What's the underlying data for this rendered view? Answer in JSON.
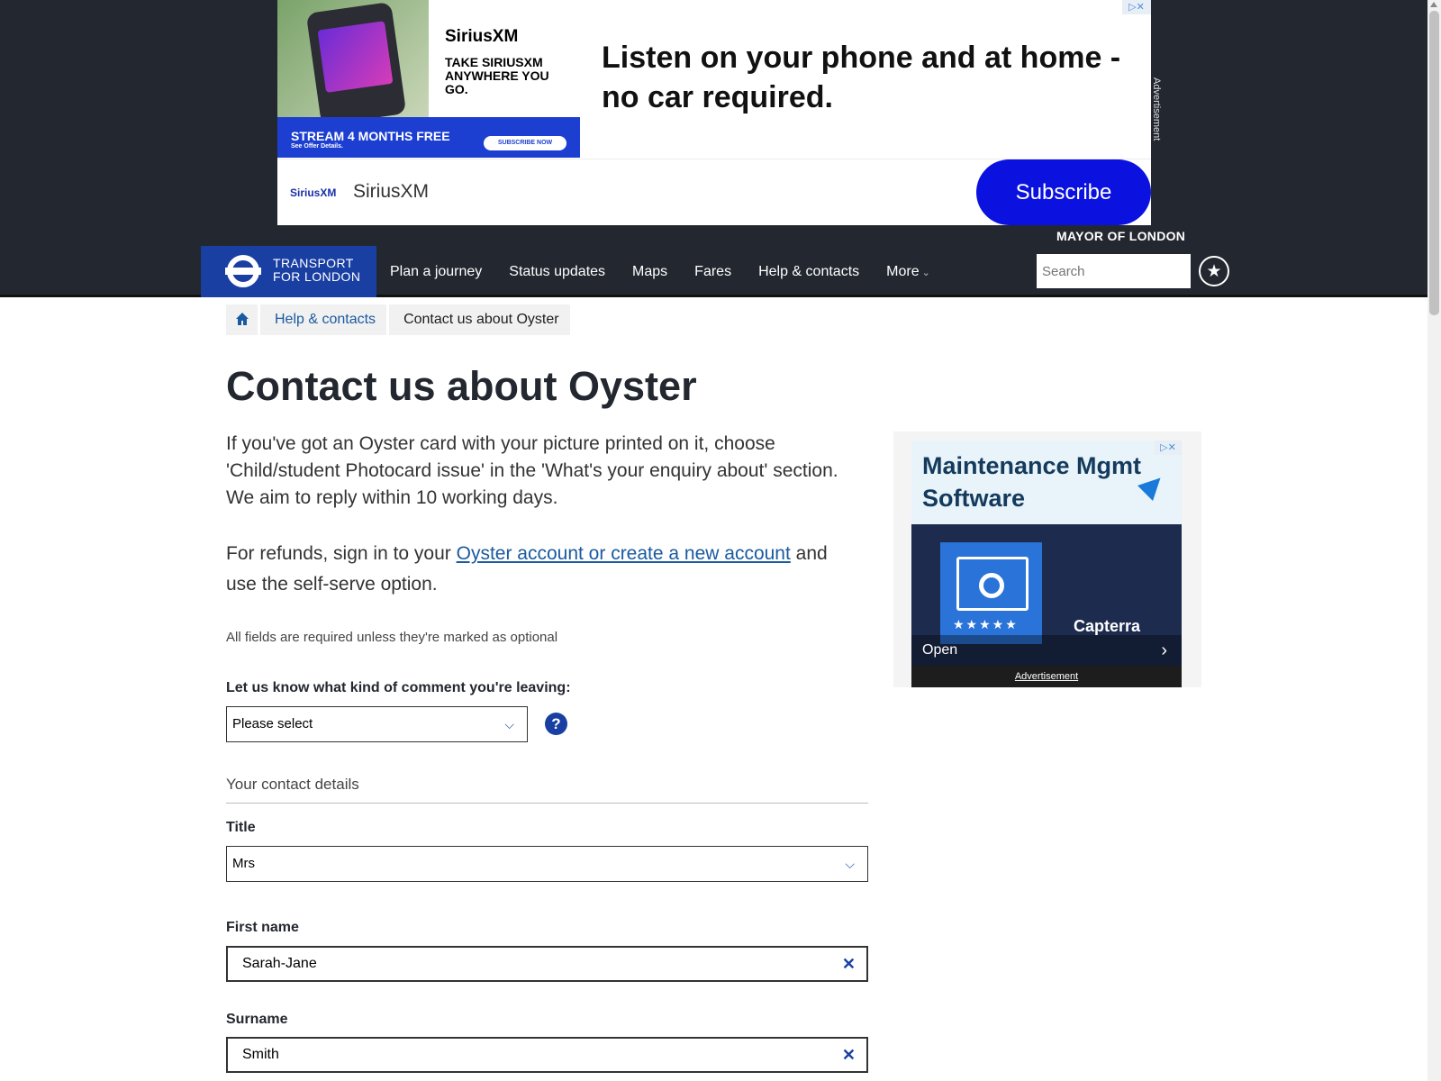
{
  "top_ad": {
    "brand": "SiriusXM",
    "tagline": "TAKE SIRIUSXM ANYWHERE YOU GO.",
    "offer": "STREAM 4 MONTHS FREE",
    "offer_sub": "See Offer Details.",
    "offer_button": "SUBSCRIBE NOW",
    "headline": "Listen on your phone and at home - no car required.",
    "small_logo": "SiriusXM",
    "sponsor": "SiriusXM",
    "cta": "Subscribe",
    "side_label": "Advertisement"
  },
  "header": {
    "mayor": "MAYOR OF LONDON",
    "brand_line1": "TRANSPORT",
    "brand_line2": "FOR LONDON",
    "nav": [
      "Plan a journey",
      "Status updates",
      "Maps",
      "Fares",
      "Help & contacts",
      "More"
    ],
    "search_placeholder": "Search"
  },
  "breadcrumb": {
    "items": [
      "Help & contacts",
      "Contact us about Oyster"
    ]
  },
  "main": {
    "title": "Contact us about Oyster",
    "intro": "If you've got an Oyster card with your picture printed on it, choose 'Child/student Photocard issue' in the 'What's your enquiry about' section. We aim to reply within 10 working days.",
    "refund_prefix": "For refunds, sign in to your ",
    "refund_link": "Oyster account or create a new account",
    "refund_suffix": " and use the self-serve option.",
    "required_note": "All fields are required unless they're marked as optional",
    "comment_label": "Let us know what kind of comment you're leaving:",
    "comment_value": "Please select",
    "contact_section": "Your contact details",
    "title_label": "Title",
    "title_value": "Mrs",
    "first_name_label": "First name",
    "first_name_value": "Sarah-Jane",
    "surname_label": "Surname",
    "surname_value": "Smith"
  },
  "side_ad": {
    "headline": "Maintenance Mgmt Software",
    "brand": "Capterra",
    "cta": "Open",
    "label": "Advertisement"
  },
  "icons": {
    "home": "home-icon",
    "star": "star-icon",
    "help": "help-icon",
    "clear": "clear-icon",
    "chevron": "chevron-down-icon"
  }
}
